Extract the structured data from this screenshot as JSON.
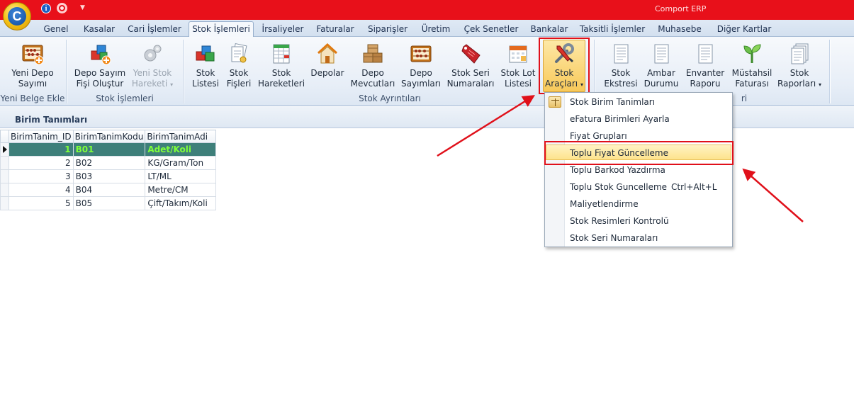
{
  "app": {
    "title": "Comport ERP",
    "logo_letter": "C",
    "info_glyph": "i",
    "qa_dropdown_glyph": "▼"
  },
  "tabs": [
    {
      "label": "Genel"
    },
    {
      "label": "Kasalar"
    },
    {
      "label": "Cari İşlemler"
    },
    {
      "label": "Stok İşlemleri",
      "active": true
    },
    {
      "label": "İrsaliyeler"
    },
    {
      "label": "Faturalar"
    },
    {
      "label": "Siparişler"
    },
    {
      "label": "Üretim"
    },
    {
      "label": "Çek Senetler"
    },
    {
      "label": "Bankalar"
    },
    {
      "label": "Taksitli İşlemler"
    },
    {
      "label": "Muhasebe"
    },
    {
      "label": "Diğer Kartlar"
    }
  ],
  "ribbon": {
    "groups": {
      "yeni_belge": "Yeni Belge Ekle",
      "stok_islemleri": "Stok İşlemleri",
      "stok_ayrintilari": "Stok Ayrıntıları",
      "reports_fragment": "ri"
    },
    "buttons": {
      "yeni_depo_sayimi": [
        "Yeni Depo",
        "Sayımı"
      ],
      "depo_sayim_fisi": [
        "Depo Sayım",
        "Fişi Oluştur"
      ],
      "yeni_stok_hareketi": [
        "Yeni Stok",
        "Hareketi"
      ],
      "stok_listesi": [
        "Stok",
        "Listesi"
      ],
      "stok_fisleri": [
        "Stok",
        "Fişleri"
      ],
      "stok_hareketleri": [
        "Stok",
        "Hareketleri"
      ],
      "depolar": [
        "Depolar"
      ],
      "depo_mevcutlari": [
        "Depo",
        "Mevcutları"
      ],
      "depo_sayimlari": [
        "Depo",
        "Sayımları"
      ],
      "stok_seri_numaralari": [
        "Stok Seri",
        "Numaraları"
      ],
      "stok_lot_listesi": [
        "Stok Lot",
        "Listesi"
      ],
      "stok_araclari": [
        "Stok",
        "Araçları"
      ],
      "stok_ekstresi": [
        "Stok",
        "Ekstresi"
      ],
      "ambar_durumu": [
        "Ambar",
        "Durumu"
      ],
      "envanter_raporu": [
        "Envanter",
        "Raporu"
      ],
      "mustahsil_faturasi": [
        "Müstahsil",
        "Faturası"
      ],
      "stok_raporlari": [
        "Stok",
        "Raporları"
      ]
    }
  },
  "section": {
    "title": "Birim Tanımları"
  },
  "grid": {
    "columns": [
      "BirimTanim_ID",
      "BirimTanimKodu",
      "BirimTanimAdi"
    ],
    "rows": [
      {
        "id": "1",
        "code": "B01",
        "name": "Adet/Koli",
        "selected": true
      },
      {
        "id": "2",
        "code": "B02",
        "name": "KG/Gram/Ton"
      },
      {
        "id": "3",
        "code": "B03",
        "name": "LT/ML"
      },
      {
        "id": "4",
        "code": "B04",
        "name": "Metre/CM"
      },
      {
        "id": "5",
        "code": "B05",
        "name": "Çift/Takım/Koli"
      }
    ]
  },
  "menu": {
    "items": [
      {
        "label": "Stok Birim Tanimları",
        "shortcut": ""
      },
      {
        "label": "eFatura Birimleri Ayarla",
        "shortcut": ""
      },
      {
        "label": "Fiyat Grupları",
        "shortcut": ""
      },
      {
        "label": "Toplu Fiyat Güncelleme",
        "shortcut": "",
        "highlighted": true
      },
      {
        "label": "Toplu Barkod Yazdırma",
        "shortcut": ""
      },
      {
        "label": "Toplu Stok Guncelleme",
        "shortcut": "Ctrl+Alt+L"
      },
      {
        "label": "Maliyetlendirme",
        "shortcut": ""
      },
      {
        "label": "Stok Resimleri Kontrolü",
        "shortcut": ""
      },
      {
        "label": "Stok Seri Numaraları",
        "shortcut": ""
      }
    ]
  },
  "colors": {
    "titlebar": "#e8101a",
    "selection_row": "#3e7f7a",
    "selection_text": "#7fff3a",
    "annotation": "#e0101a",
    "menu_highlight": "#fde38c"
  }
}
